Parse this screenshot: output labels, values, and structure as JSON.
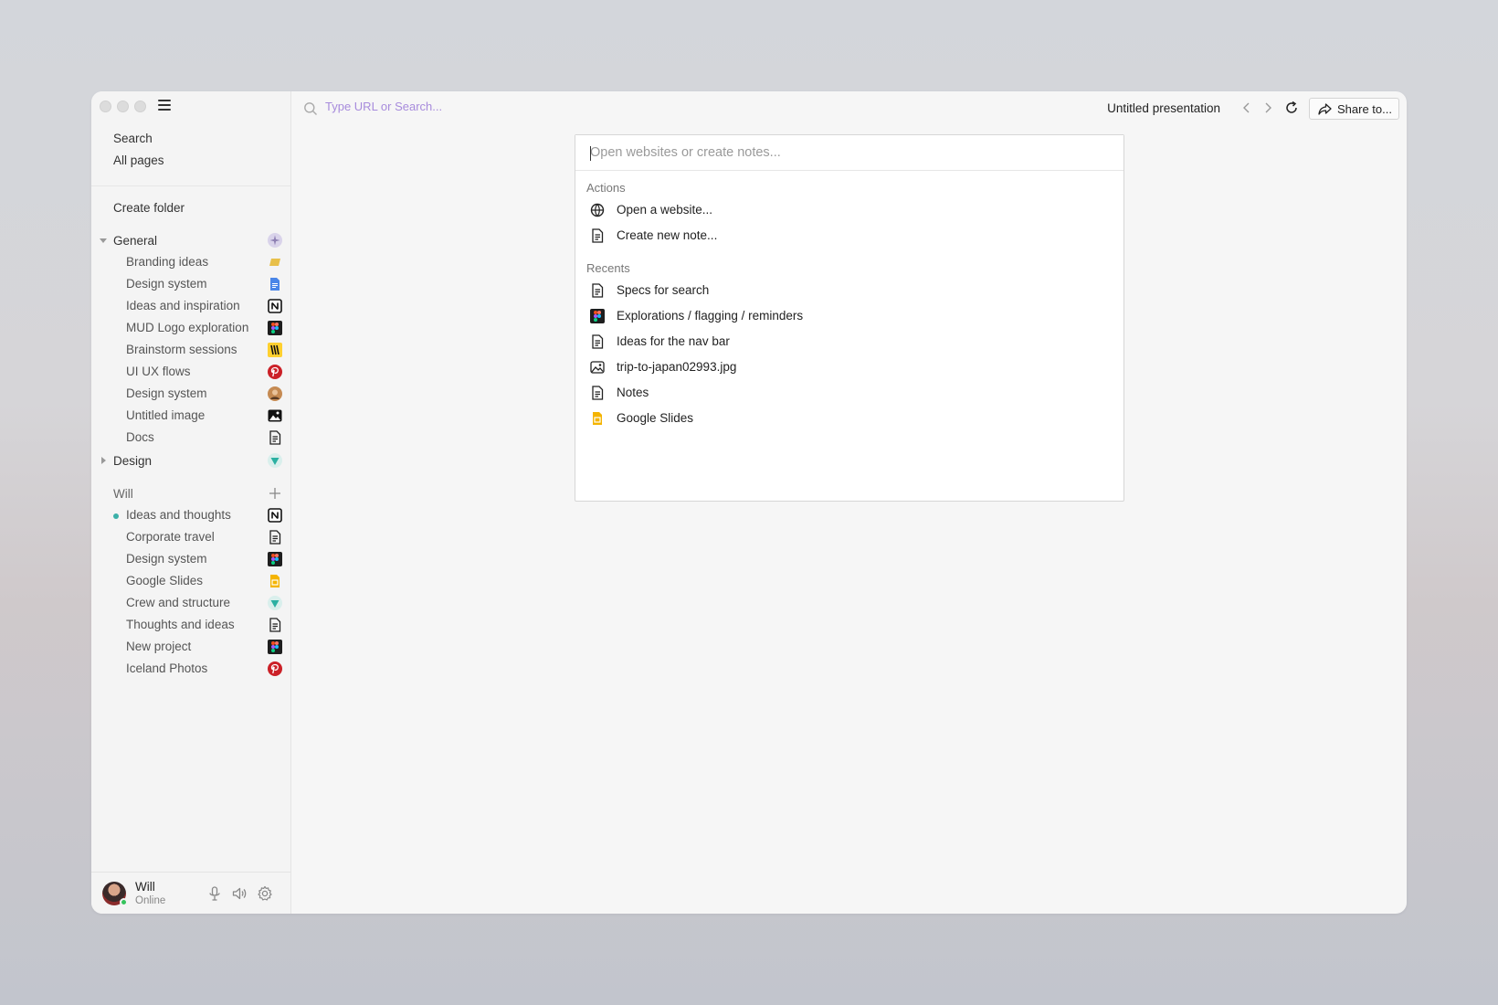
{
  "sidebar": {
    "top_links": [
      "Search",
      "All pages"
    ],
    "create_folder": "Create folder",
    "groups": [
      {
        "name": "General",
        "icon": "sparkle-icon",
        "items": [
          {
            "label": "Branding ideas",
            "icon": "yellow-tag-icon"
          },
          {
            "label": "Design system",
            "icon": "google-docs-icon"
          },
          {
            "label": "Ideas and inspiration",
            "icon": "notion-icon"
          },
          {
            "label": "MUD Logo exploration",
            "icon": "figma-icon"
          },
          {
            "label": "Brainstorm sessions",
            "icon": "miro-icon"
          },
          {
            "label": "UI UX flows",
            "icon": "pinterest-icon"
          },
          {
            "label": "Design system",
            "icon": "photo-avatar-icon"
          },
          {
            "label": "Untitled image",
            "icon": "image-icon"
          },
          {
            "label": "Docs",
            "icon": "document-icon"
          }
        ]
      },
      {
        "name": "Design",
        "icon": "teal-triangle-icon",
        "items": []
      },
      {
        "name": "Will",
        "icon": "plus-icon",
        "items": [
          {
            "label": "Ideas and thoughts",
            "icon": "notion-icon",
            "active": true
          },
          {
            "label": "Corporate travel",
            "icon": "document-icon"
          },
          {
            "label": "Design system",
            "icon": "figma-icon"
          },
          {
            "label": "Google Slides",
            "icon": "google-slides-icon"
          },
          {
            "label": "Crew and structure",
            "icon": "teal-triangle-icon"
          },
          {
            "label": "Thoughts and ideas",
            "icon": "document-icon"
          },
          {
            "label": "New project",
            "icon": "figma-icon"
          },
          {
            "label": "Iceland Photos",
            "icon": "pinterest-icon"
          }
        ]
      }
    ],
    "user": {
      "name": "Will",
      "status": "Online",
      "status_color": "#35c35c"
    }
  },
  "toolbar": {
    "url_placeholder": "Type URL or Search...",
    "title": "Untitled presentation",
    "share_label": "Share to..."
  },
  "palette": {
    "placeholder": "Open websites or create notes...",
    "actions_title": "Actions",
    "actions": [
      {
        "label": "Open a website...",
        "icon": "globe-icon"
      },
      {
        "label": "Create new note...",
        "icon": "document-icon"
      }
    ],
    "recents_title": "Recents",
    "recents": [
      {
        "label": "Specs for search",
        "icon": "document-icon"
      },
      {
        "label": "Explorations / flagging / reminders",
        "icon": "figma-icon"
      },
      {
        "label": "Ideas for the nav bar",
        "icon": "document-icon"
      },
      {
        "label": "trip-to-japan02993.jpg",
        "icon": "image-icon"
      },
      {
        "label": "Notes",
        "icon": "document-icon"
      },
      {
        "label": "Google Slides",
        "icon": "google-slides-icon"
      }
    ]
  },
  "colors": {
    "accent_teal": "#3bb0a8",
    "url_text": "#a78bdc"
  }
}
